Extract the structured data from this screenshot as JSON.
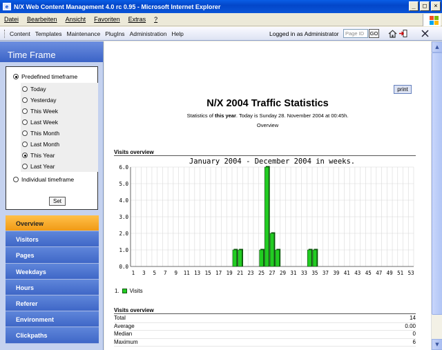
{
  "window": {
    "title": "N/X Web Content Management 4.0 rc 0.95 - Microsoft Internet Explorer",
    "app_icon": "e",
    "buttons": {
      "minimize": "_",
      "maximize": "□",
      "close": "×"
    }
  },
  "menubar": [
    "Datei",
    "Bearbeiten",
    "Ansicht",
    "Favoriten",
    "Extras",
    "?"
  ],
  "appnav": {
    "items": [
      "Content",
      "Templates",
      "Maintenance",
      "PlugIns",
      "Administration",
      "Help"
    ],
    "login_text": "Logged in as Administrator",
    "pageid_placeholder": "Page ID",
    "go_label": "GO"
  },
  "timeframe": {
    "title": "Time Frame",
    "predefined_label": "Predefined timeframe",
    "options": [
      "Today",
      "Yesterday",
      "This Week",
      "Last Week",
      "This Month",
      "Last Month",
      "This Year",
      "Last Year"
    ],
    "selected": "This Year",
    "individual_label": "Individual timeframe",
    "set_label": "Set"
  },
  "nav": {
    "items": [
      "Overview",
      "Visitors",
      "Pages",
      "Weekdays",
      "Hours",
      "Referer",
      "Environment",
      "Clickpaths"
    ],
    "active": "Overview"
  },
  "main": {
    "print_label": "print",
    "title": "N/X 2004 Traffic Statistics",
    "subtitle_pre": "Statistics of ",
    "subtitle_bold": "this year",
    "subtitle_post": ". Today is Sunday 28. November 2004 at 00:45h.",
    "subtitle2": "Overview",
    "section1": "Visits overview",
    "section2": "Visits overview",
    "legend_index": "1.",
    "legend_label": "Visits",
    "stats": [
      {
        "label": "Total",
        "value": "14"
      },
      {
        "label": "Average",
        "value": "0.00"
      },
      {
        "label": "Median",
        "value": "0"
      },
      {
        "label": "Maximum",
        "value": "6"
      }
    ]
  },
  "colors": {
    "bar": "#22cc22",
    "bar_dark": "#0c5a0c",
    "nav_active": "#f4a620"
  },
  "chart_data": {
    "type": "bar",
    "title": "January 2004   -   December 2004 in weeks.",
    "xlabel": "",
    "ylabel": "",
    "ylim": [
      0,
      6
    ],
    "yticks": [
      "0.0",
      "1.0",
      "2.0",
      "3.0",
      "4.0",
      "5.0",
      "6.0"
    ],
    "x_tick_labels": [
      "1",
      "3",
      "5",
      "7",
      "9",
      "11",
      "13",
      "15",
      "17",
      "19",
      "21",
      "23",
      "25",
      "27",
      "29",
      "31",
      "33",
      "35",
      "37",
      "39",
      "41",
      "43",
      "45",
      "47",
      "49",
      "51",
      "53"
    ],
    "categories": [
      1,
      2,
      3,
      4,
      5,
      6,
      7,
      8,
      9,
      10,
      11,
      12,
      13,
      14,
      15,
      16,
      17,
      18,
      19,
      20,
      21,
      22,
      23,
      24,
      25,
      26,
      27,
      28,
      29,
      30,
      31,
      32,
      33,
      34,
      35,
      36,
      37,
      38,
      39,
      40,
      41,
      42,
      43,
      44,
      45,
      46,
      47,
      48,
      49,
      50,
      51,
      52,
      53
    ],
    "series": [
      {
        "name": "Visits",
        "values": [
          0,
          0,
          0,
          0,
          0,
          0,
          0,
          0,
          0,
          0,
          0,
          0,
          0,
          0,
          0,
          0,
          0,
          0,
          0,
          1,
          1,
          0,
          0,
          0,
          1,
          6,
          2,
          1,
          0,
          0,
          0,
          0,
          0,
          1,
          1,
          0,
          0,
          0,
          0,
          0,
          0,
          0,
          0,
          0,
          0,
          0,
          0,
          0,
          0,
          0,
          0,
          0,
          0
        ]
      }
    ],
    "grid": true
  }
}
